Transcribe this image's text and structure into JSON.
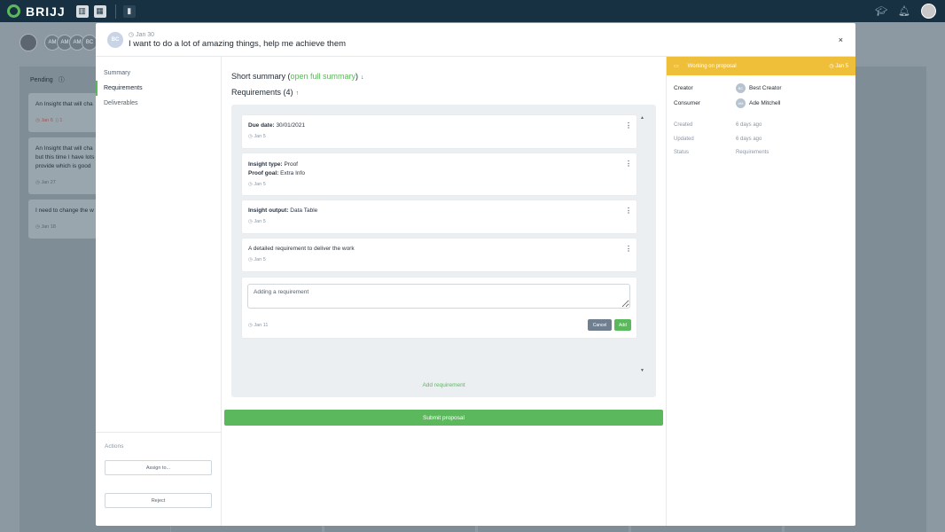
{
  "app": {
    "name": "BRIJJ"
  },
  "board": {
    "column_title": "Pending",
    "cards": [
      {
        "text": "An Insight that will cha",
        "date": "Jan 6",
        "count": "1"
      },
      {
        "text_lines": [
          "An Insight that will cha",
          "but this time I have lots",
          "provide which is good"
        ],
        "date": "Jan 27"
      },
      {
        "text": "I need to change the w",
        "date": "Jan 18"
      }
    ],
    "avatars": [
      "AM",
      "AM",
      "AM",
      "BC"
    ]
  },
  "modal": {
    "avatar": "BC",
    "date": "Jan 30",
    "title": "I want to do a lot of amazing things, help me achieve them",
    "close": "×",
    "nav": [
      "Summary",
      "Requirements",
      "Deliverables"
    ],
    "actions_label": "Actions",
    "assign_label": "Assign to...",
    "reject_label": "Reject",
    "summary_prefix": "Short summary (",
    "summary_link": "open full summary",
    "summary_suffix": ")",
    "requirements_label": "Requirements (4)",
    "requirements": [
      {
        "lines": [
          {
            "label": "Due date:",
            "value": "30/01/2021"
          }
        ],
        "date": "Jan 5"
      },
      {
        "lines": [
          {
            "label": "Insight type:",
            "value": "Proof"
          },
          {
            "label": "Proof goal:",
            "value": "Extra Info"
          }
        ],
        "date": "Jan 5"
      },
      {
        "lines": [
          {
            "label": "Insight output:",
            "value": "Data Table"
          }
        ],
        "date": "Jan 5"
      },
      {
        "lines": [
          {
            "label": "",
            "value": "A detailed requirement to deliver the work"
          }
        ],
        "date": "Jan 5"
      }
    ],
    "new_requirement": {
      "value": "Adding a requirement",
      "date": "Jan 11",
      "cancel": "Cancel",
      "add": "Add"
    },
    "add_requirement_link": "Add requirement",
    "submit_label": "Submit proposal",
    "status": {
      "label": "Working on proposal",
      "date": "Jan 5",
      "color": "#f0bf3a"
    },
    "creator_label": "Creator",
    "creator": {
      "initials": "BC",
      "name": "Best Creator"
    },
    "consumer_label": "Consumer",
    "consumer": {
      "initials": "AM",
      "name": "Ade Mitchell"
    },
    "created_label": "Created",
    "created_value": "6 days ago",
    "updated_label": "Updated",
    "updated_value": "6 days ago",
    "status_label": "Status",
    "status_value": "Requirements"
  }
}
